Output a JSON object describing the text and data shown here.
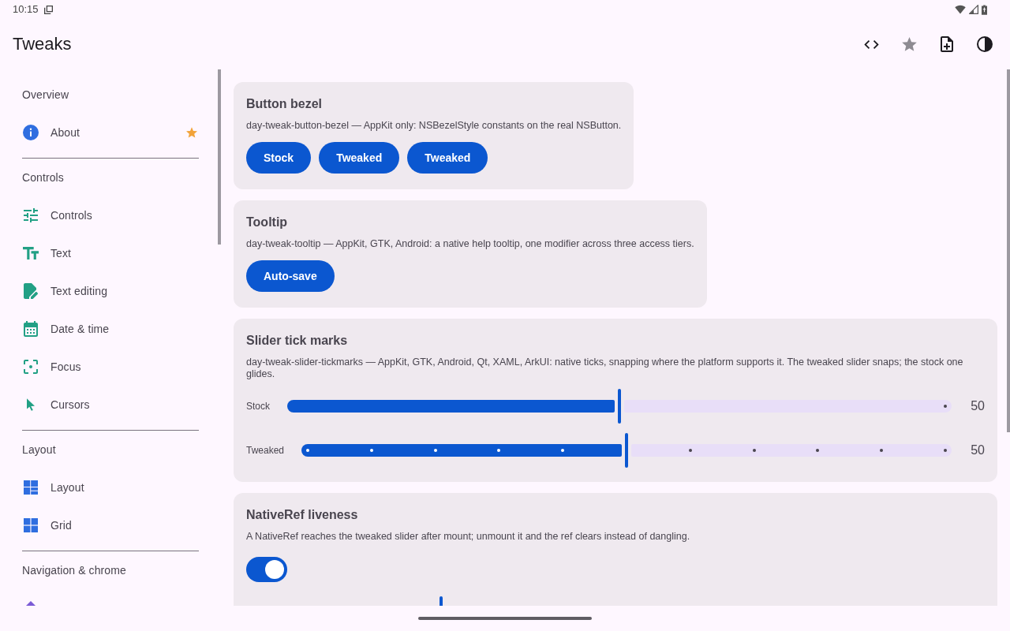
{
  "status_bar": {
    "time": "10:15"
  },
  "app_bar": {
    "title": "Tweaks",
    "actions": [
      {
        "kind": "code"
      },
      {
        "kind": "star"
      },
      {
        "kind": "note-add"
      },
      {
        "kind": "contrast"
      }
    ]
  },
  "sidebar": {
    "sections": [
      {
        "heading": "Overview",
        "items": [
          {
            "label": "About",
            "kind": "info",
            "starred": true
          }
        ]
      },
      {
        "heading": "Controls",
        "items": [
          {
            "label": "Controls",
            "kind": "sliders",
            "starred": false
          },
          {
            "label": "Text",
            "kind": "text",
            "starred": false
          },
          {
            "label": "Text editing",
            "kind": "edit",
            "starred": false
          },
          {
            "label": "Date & time",
            "kind": "calendar",
            "starred": false
          },
          {
            "label": "Focus",
            "kind": "focus",
            "starred": false
          },
          {
            "label": "Cursors",
            "kind": "cursor",
            "starred": false
          }
        ]
      },
      {
        "heading": "Layout",
        "items": [
          {
            "label": "Layout",
            "kind": "dashboard",
            "starred": false
          },
          {
            "label": "Grid",
            "kind": "grid",
            "starred": false
          }
        ]
      },
      {
        "heading": "Navigation & chrome",
        "items": [
          {
            "kind": "diamond"
          }
        ]
      }
    ]
  },
  "cards": [
    {
      "kind": "buttons",
      "title": "Button bezel",
      "description": "day-tweak-button-bezel — AppKit only: NSBezelStyle constants on the real NSButton.",
      "buttons": [
        "Stock",
        "Tweaked",
        "Tweaked"
      ]
    },
    {
      "kind": "buttons",
      "title": "Tooltip",
      "description": "day-tweak-tooltip — AppKit, GTK, Android: a native help tooltip, one modifier across three access tiers.",
      "buttons": [
        "Auto-save"
      ]
    },
    {
      "kind": "sliders",
      "title": "Slider tick marks",
      "description": "day-tweak-slider-tickmarks — AppKit, GTK, Android, Qt, XAML, ArkUI: native ticks, snapping where the platform supports it. The tweaked slider snaps; the stock one glides.",
      "sliders": [
        {
          "label": "Stock",
          "kind": "continuous",
          "level": 0.5,
          "reading": "50"
        },
        {
          "label": "Tweaked",
          "kind": "discrete",
          "level": 0.5,
          "reading": "50"
        }
      ]
    },
    {
      "kind": "toggle",
      "title": "NativeRef liveness",
      "description": "A NativeRef reaches the tweaked slider after mount; unmount it and the ref clears instead of dangling.",
      "switch": {
        "on": true
      },
      "slider": {
        "level": 0.26
      }
    }
  ]
}
